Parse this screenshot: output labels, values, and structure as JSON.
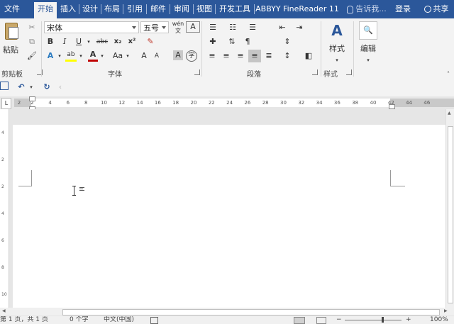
{
  "tabs": [
    {
      "label": "文件",
      "active": false
    },
    {
      "label": "开始",
      "active": true
    },
    {
      "label": "插入",
      "active": false
    },
    {
      "label": "设计",
      "active": false
    },
    {
      "label": "布局",
      "active": false
    },
    {
      "label": "引用",
      "active": false
    },
    {
      "label": "邮件",
      "active": false
    },
    {
      "label": "审阅",
      "active": false
    },
    {
      "label": "视图",
      "active": false
    },
    {
      "label": "开发工具",
      "active": false
    },
    {
      "label": "ABBYY FineReader 11",
      "active": false
    }
  ],
  "tell_me": "告诉我...",
  "login": "登录",
  "share": "共享",
  "clipboard": {
    "paste_label": "粘贴",
    "group_label": "剪贴板"
  },
  "font": {
    "font_name": "宋体",
    "font_size": "五号",
    "group_label": "字体",
    "format_labels": {
      "bold": "B",
      "italic": "I",
      "underline": "U",
      "strike": "abc",
      "subscript": "x₂",
      "superscript": "x²",
      "grow": "A",
      "shrink": "A",
      "case": "Aa",
      "char_shade": "A",
      "enclose": "字"
    }
  },
  "paragraph": {
    "group_label": "段落"
  },
  "styles": {
    "button_label": "样式",
    "group_label": "样式"
  },
  "editing": {
    "button_label": "编辑"
  },
  "ruler": {
    "labels": [
      "2",
      "2",
      "4",
      "6",
      "8",
      "10",
      "12",
      "14",
      "16",
      "18",
      "20",
      "22",
      "24",
      "26",
      "28",
      "30",
      "32",
      "34",
      "36",
      "38",
      "40",
      "42",
      "44",
      "46"
    ]
  },
  "vruler": {
    "labels": [
      "4",
      "2",
      "2",
      "4",
      "6",
      "8",
      "10"
    ]
  },
  "status": {
    "page": "第 1 页，共 1 页",
    "words": "0 个字",
    "lang": "中文(中国)",
    "zoom": "100%"
  },
  "colors": {
    "ribbon_tab_bg": "#2b579a",
    "ribbon_bg": "#f3f3f3",
    "font_color_underline": "#c00000",
    "highlight_underline": "#ffff00"
  }
}
